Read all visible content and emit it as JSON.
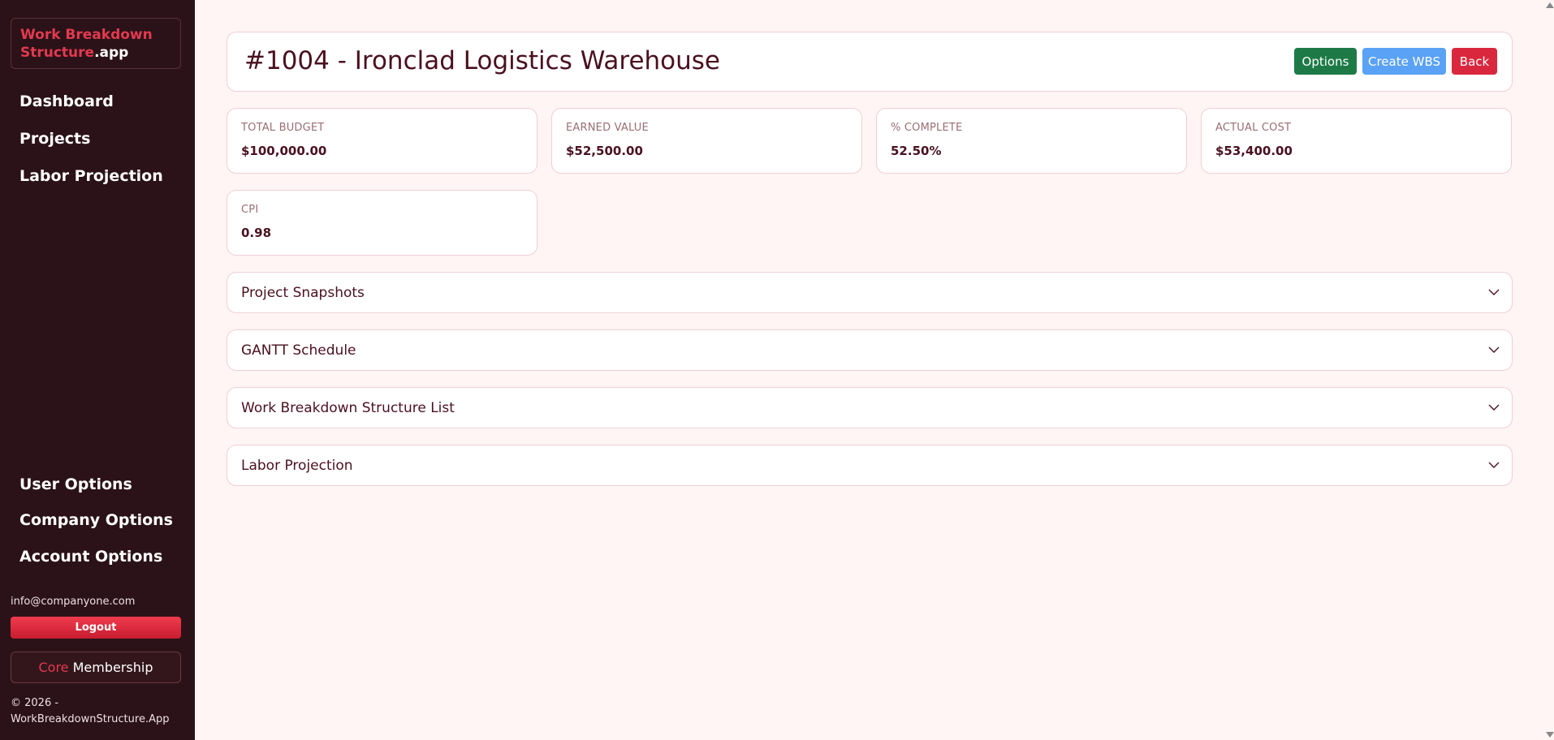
{
  "sidebar": {
    "logo_part1": "Work Breakdown",
    "logo_part2": "Structure",
    "logo_part3": ".app",
    "nav_top": [
      {
        "label": "Dashboard"
      },
      {
        "label": "Projects"
      },
      {
        "label": "Labor Projection"
      }
    ],
    "nav_bottom": [
      {
        "label": "User Options"
      },
      {
        "label": "Company Options"
      },
      {
        "label": "Account Options"
      }
    ],
    "email": "info@companyone.com",
    "logout_label": "Logout",
    "membership_core": "Core",
    "membership_label": "Membership",
    "copyright_line1": "© 2026 -",
    "copyright_line2": "WorkBreakdownStructure.App"
  },
  "header": {
    "title": "#1004 - Ironclad Logistics Warehouse",
    "options_label": "Options",
    "create_label": "Create WBS",
    "back_label": "Back"
  },
  "stats": [
    {
      "label": "TOTAL BUDGET",
      "value": "$100,000.00"
    },
    {
      "label": "EARNED VALUE",
      "value": "$52,500.00"
    },
    {
      "label": "% COMPLETE",
      "value": "52.50%"
    },
    {
      "label": "ACTUAL COST",
      "value": "$53,400.00"
    },
    {
      "label": "CPI",
      "value": "0.98"
    }
  ],
  "sections": [
    {
      "title": "Project Snapshots"
    },
    {
      "title": "GANTT Schedule"
    },
    {
      "title": "Work Breakdown Structure List"
    },
    {
      "title": "Labor Projection"
    }
  ],
  "colors": {
    "sidebar_bg": "#2b1218",
    "brand_red": "#e23a4f",
    "options_green": "#1d7a47",
    "create_blue": "#5aa2f5",
    "back_red": "#d9283e",
    "page_bg": "#fff5f5"
  },
  "icons": {
    "accordion_toggle": "chevron-down-icon"
  }
}
